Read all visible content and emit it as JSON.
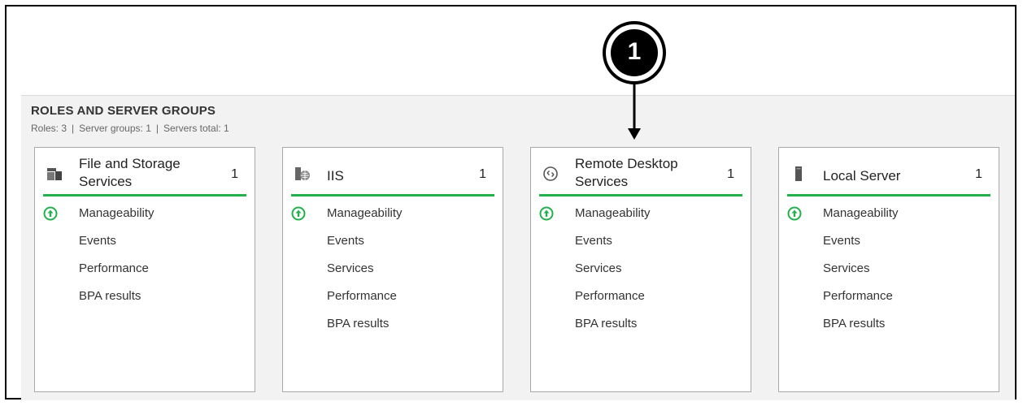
{
  "section": {
    "title": "ROLES AND SERVER GROUPS",
    "summary": {
      "roles": "Roles: 3",
      "sep": "|",
      "groups": "Server groups: 1",
      "total": "Servers total: 1"
    }
  },
  "callout": {
    "number": "1"
  },
  "accent_color": "#22b14c",
  "tiles": [
    {
      "title": "File and Storage Services",
      "count": "1",
      "icon": "file-storage-icon",
      "rows": [
        "Manageability",
        "Events",
        "Performance",
        "BPA results"
      ]
    },
    {
      "title": "IIS",
      "count": "1",
      "icon": "iis-icon",
      "rows": [
        "Manageability",
        "Events",
        "Services",
        "Performance",
        "BPA results"
      ]
    },
    {
      "title": "Remote Desktop Services",
      "count": "1",
      "icon": "remote-desktop-icon",
      "rows": [
        "Manageability",
        "Events",
        "Services",
        "Performance",
        "BPA results"
      ]
    },
    {
      "title": "Local Server",
      "count": "1",
      "icon": "local-server-icon",
      "rows": [
        "Manageability",
        "Events",
        "Services",
        "Performance",
        "BPA results"
      ]
    }
  ]
}
